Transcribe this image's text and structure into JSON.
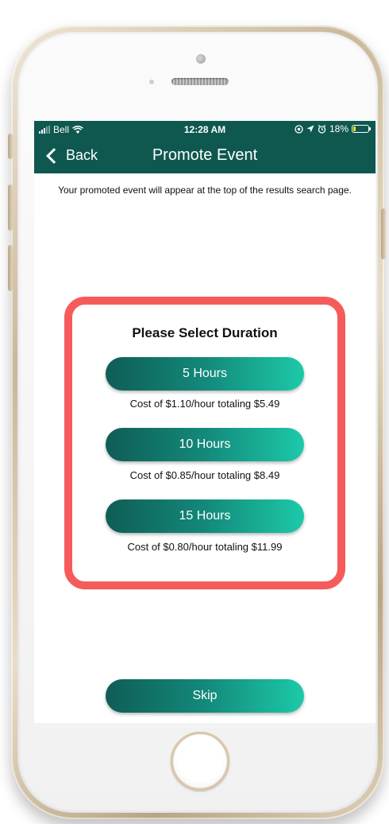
{
  "status_bar": {
    "carrier": "Bell",
    "time": "12:28 AM",
    "battery_percent": "18%",
    "icons": [
      "signal-icon",
      "wifi-icon",
      "location-lock-icon",
      "location-arrow-icon",
      "alarm-icon",
      "battery-icon"
    ]
  },
  "nav": {
    "back_label": "Back",
    "title": "Promote Event"
  },
  "intro_text": "Your promoted event will appear at the top of the results search page.",
  "dialog": {
    "title": "Please Select Duration",
    "options": [
      {
        "label": "5 Hours",
        "cost": "Cost of $1.10/hour totaling $5.49"
      },
      {
        "label": "10 Hours",
        "cost": "Cost of $0.85/hour totaling $8.49"
      },
      {
        "label": "15 Hours",
        "cost": "Cost of $0.80/hour totaling $11.99"
      }
    ]
  },
  "skip_label": "Skip",
  "colors": {
    "header": "#0f5850",
    "button_gradient_start": "#0f5d56",
    "button_gradient_end": "#1cc9a9",
    "dialog_border": "#f65b5b",
    "battery_fill": "#f2e600"
  },
  "battery_level": 0.18
}
